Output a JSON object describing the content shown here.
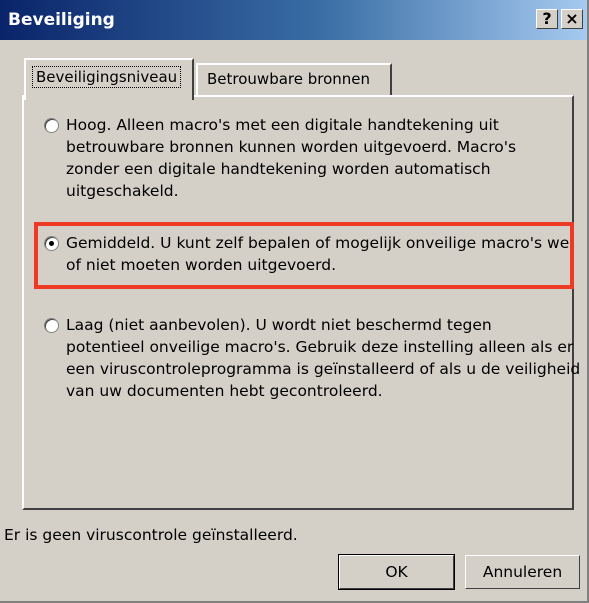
{
  "window": {
    "title": "Beveiliging",
    "help_button": "?",
    "close_button": "×"
  },
  "tabs": [
    {
      "label": "Beveiligingsniveau",
      "active": true
    },
    {
      "label": "Betrouwbare bronnen",
      "active": false
    }
  ],
  "options": [
    {
      "id": "hoog",
      "selected": false,
      "text": "Hoog. Alleen macro's met een digitale handtekening uit\nbetrouwbare bronnen kunnen worden uitgevoerd. Macro's\nzonder een digitale handtekening worden automatisch\nuitgeschakeld."
    },
    {
      "id": "gemiddeld",
      "selected": true,
      "text": "Gemiddeld. U kunt zelf bepalen of mogelijk onveilige macro's wel\nof niet moeten worden uitgevoerd."
    },
    {
      "id": "laag",
      "selected": false,
      "text": "Laag (niet aanbevolen). U wordt niet beschermd tegen\npotentieel onveilige macro's. Gebruik deze instelling alleen als er\neen viruscontroleprogramma is geïnstalleerd of als u de veiligheid\nvan uw documenten hebt gecontroleerd."
    }
  ],
  "status_text": "Er is geen viruscontrole geïnstalleerd.",
  "buttons": {
    "ok": "OK",
    "cancel": "Annuleren"
  },
  "colors": {
    "title_bar": "#0a246a",
    "highlight": "#ee3a24",
    "dialog_face": "#d4d0c8"
  }
}
